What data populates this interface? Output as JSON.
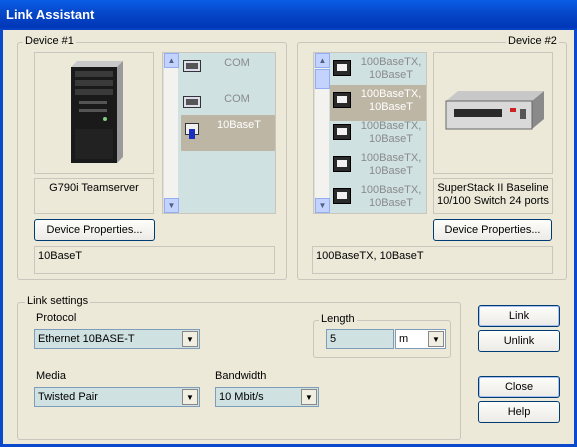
{
  "window": {
    "title": "Link Assistant"
  },
  "device1": {
    "legend": "Device #1",
    "device_name": "G790i Teamserver",
    "properties_button": "Device Properties...",
    "summary": "10BaseT",
    "ports": [
      {
        "label": "COM",
        "icon": "serial-port-icon",
        "selected": false
      },
      {
        "label": "COM",
        "icon": "serial-port-icon",
        "selected": false
      },
      {
        "label": "10BaseT",
        "icon": "ethernet-port-icon",
        "selected": true
      }
    ]
  },
  "device2": {
    "legend": "Device #2",
    "device_name_line1": "SuperStack II Baseline",
    "device_name_line2": "10/100 Switch 24 ports",
    "properties_button": "Device Properties...",
    "summary": "100BaseTX, 10BaseT",
    "ports": [
      {
        "line1": "100BaseTX,",
        "line2": "10BaseT",
        "icon": "rj45-port-icon",
        "selected": false
      },
      {
        "line1": "100BaseTX,",
        "line2": "10BaseT",
        "icon": "rj45-port-icon",
        "selected": true
      },
      {
        "line1": "100BaseTX,",
        "line2": "10BaseT",
        "icon": "rj45-port-icon",
        "selected": false
      },
      {
        "line1": "100BaseTX,",
        "line2": "10BaseT",
        "icon": "rj45-port-icon",
        "selected": false
      },
      {
        "line1": "100BaseTX,",
        "line2": "10BaseT",
        "icon": "rj45-port-icon",
        "selected": false
      }
    ]
  },
  "link_settings": {
    "legend": "Link settings",
    "protocol_label": "Protocol",
    "protocol_value": "Ethernet 10BASE-T",
    "length_legend": "Length",
    "length_value": "5",
    "length_unit": "m",
    "media_label": "Media",
    "media_value": "Twisted Pair",
    "bandwidth_label": "Bandwidth",
    "bandwidth_value": "10 Mbit/s"
  },
  "buttons": {
    "link": "Link",
    "unlink": "Unlink",
    "close": "Close",
    "help": "Help"
  }
}
